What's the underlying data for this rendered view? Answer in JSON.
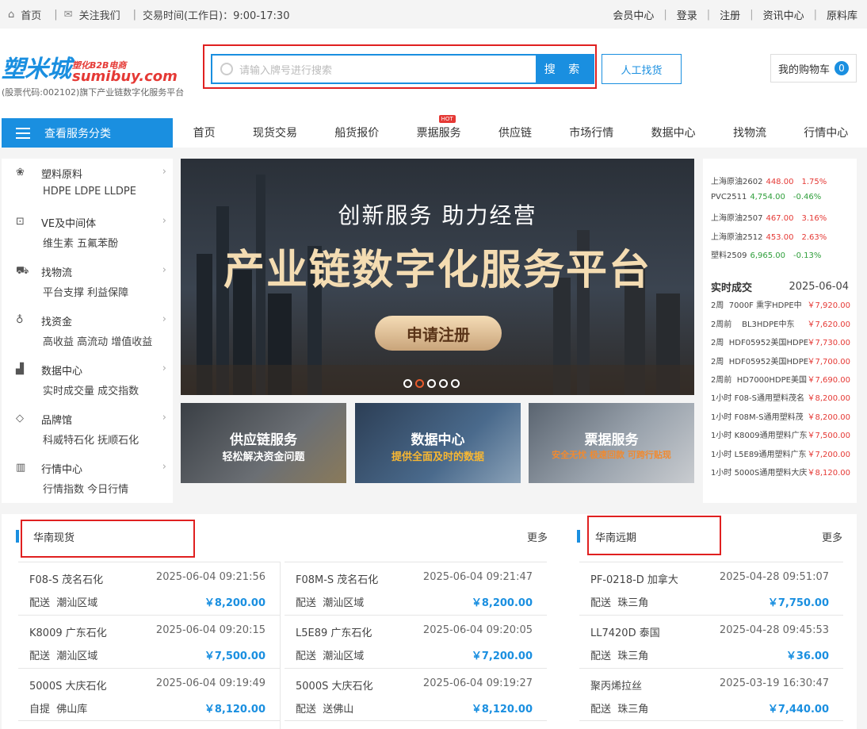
{
  "topbar": {
    "home": "首页",
    "follow": "关注我们",
    "hours": "交易时间(工作日)：9:00-17:30",
    "links": [
      "会员中心",
      "登录",
      "注册",
      "资讯中心",
      "原料库"
    ]
  },
  "logo": {
    "name": "塑米城",
    "tagline": "塑化B2B电商",
    "domain": "sumibuy.com",
    "subtitle": "(股票代码:002102)旗下产业链数字化服务平台"
  },
  "search": {
    "placeholder": "请输入牌号进行搜索",
    "button": "搜 索",
    "manual": "人工找货"
  },
  "cart": {
    "label": "我的购物车",
    "count": "0"
  },
  "category_button": "查看服务分类",
  "nav": {
    "items": [
      "首页",
      "现货交易",
      "船货报价",
      "票据服务",
      "供应链",
      "市场行情",
      "数据中心",
      "找物流",
      "行情中心"
    ],
    "hot_badge": "HOT"
  },
  "side_menu": [
    {
      "title": "塑料原料",
      "sub": "HDPE LDPE LLDPE",
      "icon": "molecule-icon"
    },
    {
      "title": "VE及中间体",
      "sub": "维生素 五氟苯酚",
      "icon": "flask-icon"
    },
    {
      "title": "找物流",
      "sub": "平台支撑 利益保障",
      "icon": "truck-icon"
    },
    {
      "title": "找资金",
      "sub": "高收益 高流动 增值收益",
      "icon": "money-bag-icon"
    },
    {
      "title": "数据中心",
      "sub": "实时成交量 成交指数",
      "icon": "chart-icon"
    },
    {
      "title": "品牌馆",
      "sub": "科威特石化 抚顺石化",
      "icon": "diamond-icon"
    },
    {
      "title": "行情中心",
      "sub": "行情指数 今日行情",
      "icon": "bar-chart-icon"
    }
  ],
  "banner": {
    "subtitle": "创新服务 助力经营",
    "title": "产业链数字化服务平台",
    "cta": "申请注册",
    "slide_count": 5,
    "active_slide": 2
  },
  "promos": [
    {
      "title": "供应链服务",
      "sub": "轻松解决资金问题"
    },
    {
      "title": "数据中心",
      "sub": "提供全面及时的数据"
    },
    {
      "title": "票据服务",
      "sub": "安全无忧 极速回款 可跨行贴现"
    }
  ],
  "quotes": [
    {
      "name": "上海原油2602",
      "price": "448.00",
      "change": "1.75%",
      "dir": "up"
    },
    {
      "name": "PVC2511",
      "price": "4,754.00",
      "change": "-0.46%",
      "dir": "down"
    },
    {
      "name": "上海原油2507",
      "price": "467.00",
      "change": "3.16%",
      "dir": "up"
    },
    {
      "name": "上海原油2512",
      "price": "453.00",
      "change": "2.63%",
      "dir": "up"
    },
    {
      "name": "塑料2509",
      "price": "6,965.00",
      "change": "-0.13%",
      "dir": "down"
    }
  ],
  "realtime": {
    "title": "实时成交",
    "date": "2025-06-04",
    "rows": [
      {
        "time": "2周",
        "desc": "7000F 熏字HDPE中",
        "price": "￥7,920.00"
      },
      {
        "time": "2周前",
        "desc": "BL3HDPE中东",
        "price": "￥7,620.00"
      },
      {
        "time": "2周",
        "desc": "HDF05952美国HDPE",
        "price": "￥7,730.00"
      },
      {
        "time": "2周",
        "desc": "HDF05952美国HDPE",
        "price": "￥7,700.00"
      },
      {
        "time": "2周前",
        "desc": "HD7000HDPE美国",
        "price": "￥7,690.00"
      },
      {
        "time": "1小时",
        "desc": "F08-S通用塑料茂名",
        "price": "￥8,200.00"
      },
      {
        "time": "1小时",
        "desc": "F08M-S通用塑料茂",
        "price": "￥8,200.00"
      },
      {
        "time": "1小时",
        "desc": "K8009通用塑料广东",
        "price": "￥7,500.00"
      },
      {
        "time": "1小时",
        "desc": "L5E89通用塑料广东",
        "price": "￥7,200.00"
      },
      {
        "time": "1小时",
        "desc": "5000S通用塑料大庆",
        "price": "￥8,120.00"
      }
    ]
  },
  "south_spot": {
    "title": "华南现货",
    "more": "更多",
    "items": [
      {
        "name": "F08-S  茂名石化",
        "time": "2025-06-04 09:21:56",
        "mode": "配送",
        "area": "潮汕区域",
        "price": "￥8,200.00"
      },
      {
        "name": "F08M-S  茂名石化",
        "time": "2025-06-04 09:21:47",
        "mode": "配送",
        "area": "潮汕区域",
        "price": "￥8,200.00"
      },
      {
        "name": "K8009  广东石化",
        "time": "2025-06-04 09:20:15",
        "mode": "配送",
        "area": "潮汕区域",
        "price": "￥7,500.00"
      },
      {
        "name": "L5E89  广东石化",
        "time": "2025-06-04 09:20:05",
        "mode": "配送",
        "area": "潮汕区域",
        "price": "￥7,200.00"
      },
      {
        "name": "5000S  大庆石化",
        "time": "2025-06-04 09:19:49",
        "mode": "自提",
        "area": "佛山库",
        "price": "￥8,120.00"
      },
      {
        "name": "5000S  大庆石化",
        "time": "2025-06-04 09:19:27",
        "mode": "配送",
        "area": "送佛山",
        "price": "￥8,120.00"
      }
    ]
  },
  "south_future": {
    "title": "华南远期",
    "more": "更多",
    "items": [
      {
        "name": "PF-0218-D  加拿大",
        "time": "2025-04-28 09:51:07",
        "mode": "配送",
        "area": "珠三角",
        "price": "￥7,750.00"
      },
      {
        "name": "LL7420D  泰国",
        "time": "2025-04-28 09:45:53",
        "mode": "配送",
        "area": "珠三角",
        "price": "￥36.00"
      },
      {
        "name": "聚丙烯拉丝",
        "time": "2025-03-19 16:30:47",
        "mode": "配送",
        "area": "珠三角",
        "price": "￥7,440.00"
      }
    ]
  },
  "colors": {
    "accent": "#1a8fe0",
    "up": "#e53935",
    "down": "#2e9e3a",
    "highlight_box": "#e02020"
  }
}
